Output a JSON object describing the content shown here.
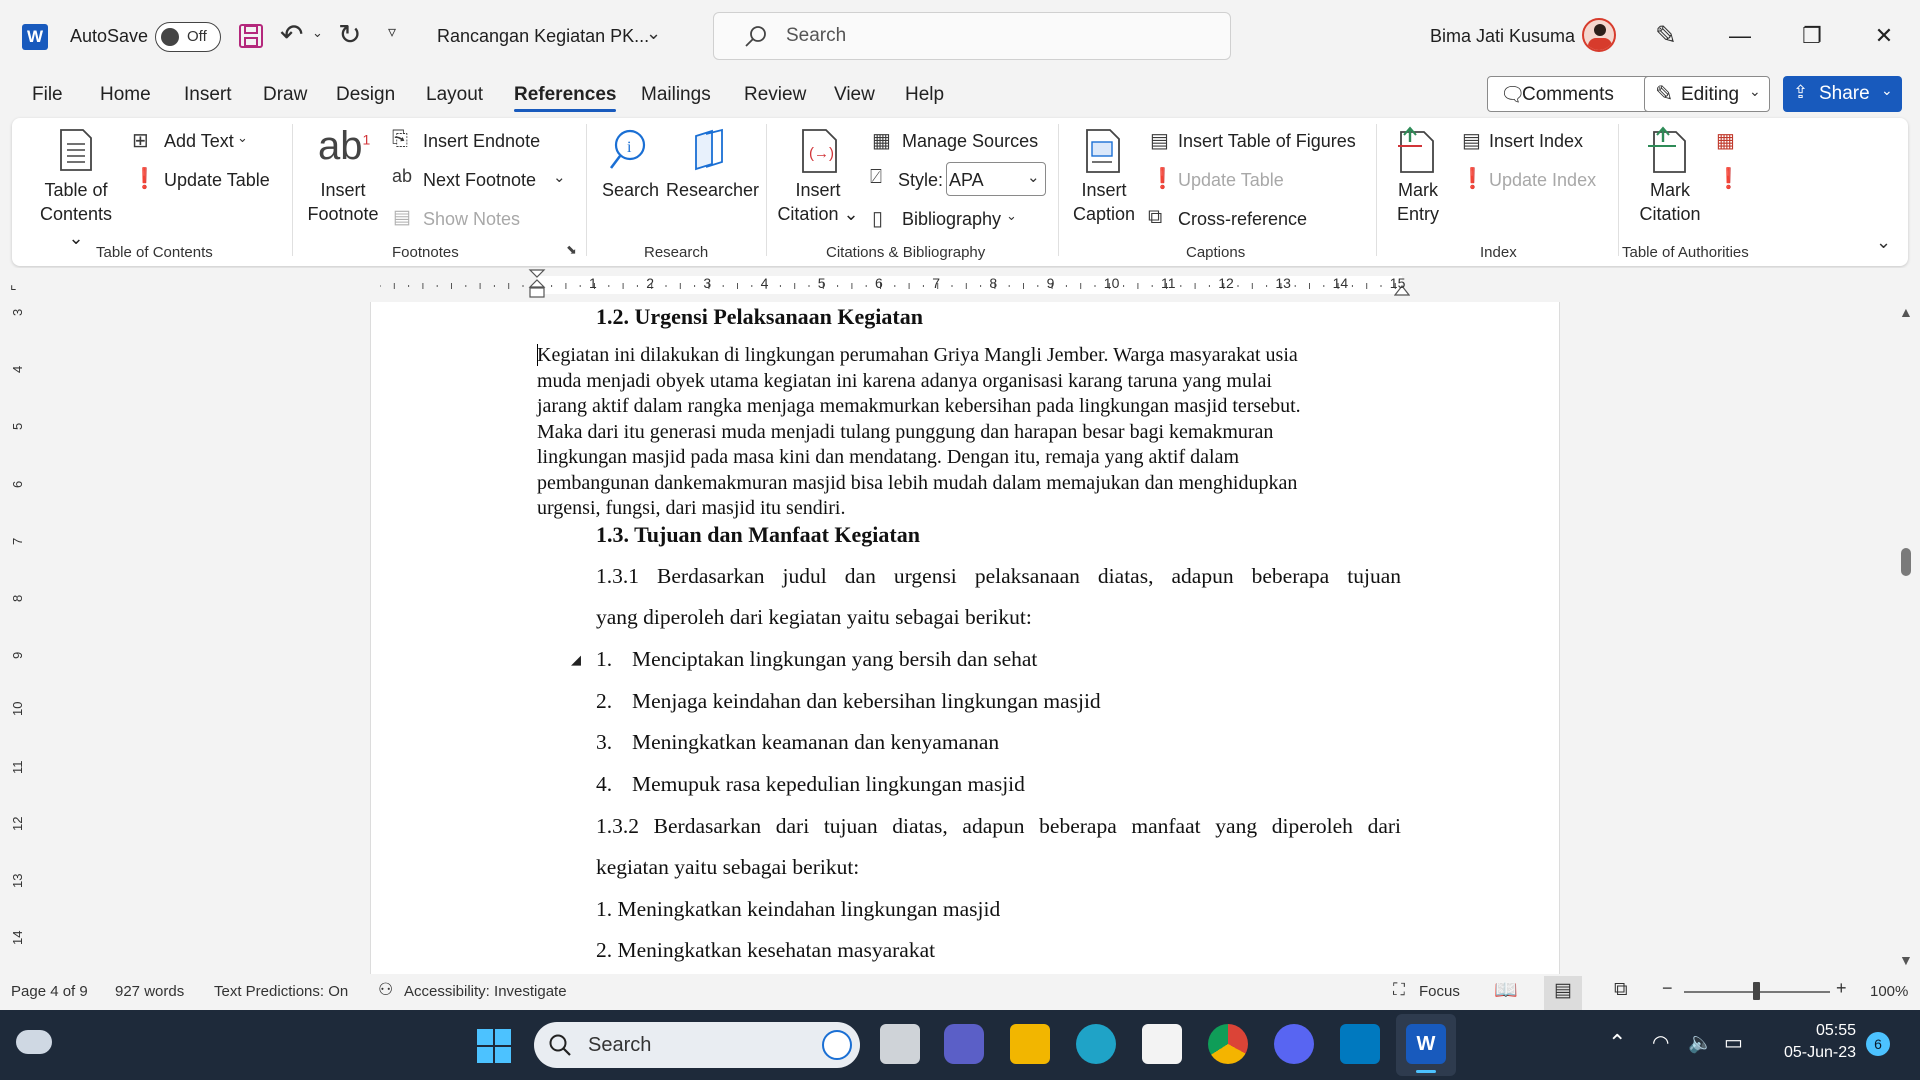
{
  "titlebar": {
    "autosave_label": "AutoSave",
    "autosave_state": "Off",
    "doc_title": "Rancangan Kegiatan PK...",
    "search_placeholder": "Search",
    "user_name": "Bima Jati Kusuma"
  },
  "menu": {
    "tabs": [
      "File",
      "Home",
      "Insert",
      "Draw",
      "Design",
      "Layout",
      "References",
      "Mailings",
      "Review",
      "View",
      "Help"
    ],
    "active": "References",
    "comments": "Comments",
    "editing": "Editing",
    "share": "Share"
  },
  "ribbon": {
    "toc": {
      "table_of_contents": "Table of\nContents",
      "toc_line1": "Table of",
      "toc_line2": "Contents",
      "add_text": "Add Text",
      "update_table": "Update Table",
      "group": "Table of Contents"
    },
    "footnotes": {
      "insert_footnote_1": "Insert",
      "insert_footnote_2": "Footnote",
      "insert_endnote": "Insert Endnote",
      "next_footnote": "Next Footnote",
      "show_notes": "Show Notes",
      "group": "Footnotes"
    },
    "research": {
      "search": "Search",
      "researcher": "Researcher",
      "group": "Research"
    },
    "citations": {
      "insert_citation_1": "Insert",
      "insert_citation_2": "Citation",
      "manage_sources": "Manage Sources",
      "style_label": "Style:",
      "style_value": "APA",
      "bibliography": "Bibliography",
      "group": "Citations & Bibliography"
    },
    "captions": {
      "insert_caption_1": "Insert",
      "insert_caption_2": "Caption",
      "insert_table_of_figures": "Insert Table of Figures",
      "update_table": "Update Table",
      "cross_reference": "Cross-reference",
      "group": "Captions"
    },
    "index": {
      "mark_entry_1": "Mark",
      "mark_entry_2": "Entry",
      "insert_index": "Insert Index",
      "update_index": "Update Index",
      "group": "Index"
    },
    "authorities": {
      "mark_citation_1": "Mark",
      "mark_citation_2": "Citation",
      "group": "Table of Authorities"
    }
  },
  "ruler": {
    "numbers": [
      "1",
      "2",
      "3",
      "4",
      "5",
      "6",
      "7",
      "8",
      "9",
      "10",
      "11",
      "12",
      "13",
      "14",
      "15"
    ]
  },
  "vruler": {
    "numbers": [
      "3",
      "4",
      "5",
      "6",
      "7",
      "8",
      "9",
      "10",
      "11",
      "12",
      "13",
      "14"
    ]
  },
  "document": {
    "heading_12": "1.2. Urgensi  Pelaksanaan Kegiatan",
    "para_lines": [
      "Kegiatan ini dilakukan di lingkungan perumahan Griya Mangli Jember. Warga masyarakat usia",
      "muda menjadi obyek utama kegiatan ini karena adanya organisasi karang taruna yang mulai",
      "jarang aktif dalam rangka menjaga memakmurkan kebersihan pada lingkungan masjid tersebut.",
      "Maka dari itu generasi muda menjadi tulang punggung dan harapan besar bagi kemakmuran",
      "lingkungan masjid pada masa kini dan mendatang. Dengan itu, remaja yang aktif dalam",
      "pembangunan dankemakmuran masjid bisa lebih mudah dalam memajukan dan menghidupkan",
      "urgensi, fungsi, dari masjid itu sendiri."
    ],
    "heading_13": "1.3. Tujuan dan Manfaat Kegiatan",
    "p131_line1": "1.3.1 Berdasarkan judul dan urgensi pelaksanaan diatas, adapun beberapa tujuan",
    "p131_line2": "yang diperoleh dari kegiatan yaitu sebagai berikut:",
    "tujuan": [
      {
        "num": "1.",
        "text": "Menciptakan lingkungan yang bersih dan sehat"
      },
      {
        "num": "2.",
        "text": "Menjaga keindahan dan kebersihan lingkungan masjid"
      },
      {
        "num": "3.",
        "text": "Meningkatkan keamanan dan kenyamanan"
      },
      {
        "num": "4.",
        "text": "Memupuk rasa kepedulian lingkungan masjid"
      }
    ],
    "p132_line1": "1.3.2 Berdasarkan dari tujuan diatas, adapun beberapa manfaat yang diperoleh dari",
    "p132_line2": "kegiatan yaitu sebagai berikut:",
    "manfaat": [
      "1. Meningkatkan keindahan lingkungan masjid",
      "2. Meningkatkan kesehatan masyarakat"
    ]
  },
  "status": {
    "page": "Page 4 of 9",
    "words": "927 words",
    "predictions": "Text Predictions: On",
    "accessibility": "Accessibility: Investigate",
    "focus": "Focus",
    "zoom": "100%"
  },
  "taskbar": {
    "search": "Search",
    "time": "05:55",
    "date": "05-Jun-23",
    "badge": "6"
  },
  "colors": {
    "accent": "#185abd",
    "taskbar": "#1e2a3a"
  }
}
